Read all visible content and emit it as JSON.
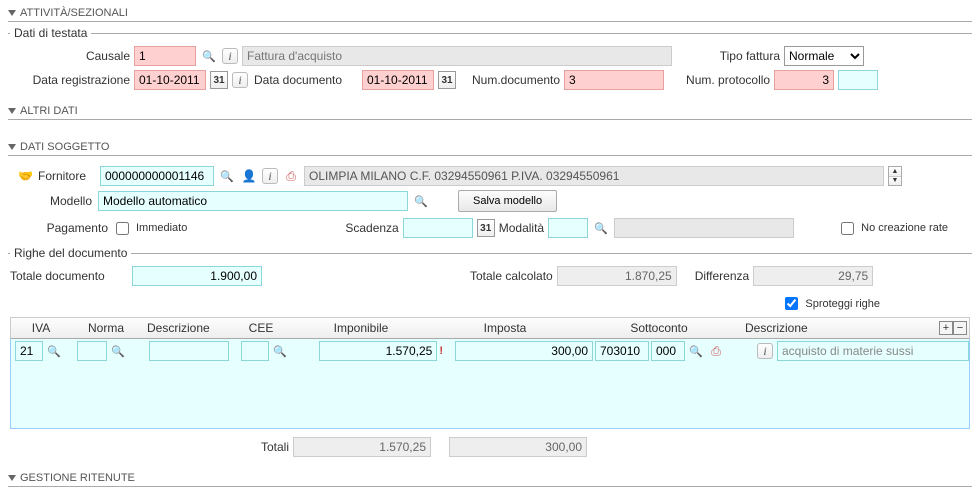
{
  "sections": {
    "attivita": "ATTIVITÀ/SEZIONALI",
    "altri": "ALTRI DATI",
    "soggetto": "DATI SOGGETTO",
    "ritenute": "GESTIONE RITENUTE"
  },
  "header": {
    "legend": "Dati di testata",
    "causale_label": "Causale",
    "causale_value": "1",
    "desc_placeholder": "Fattura d'acquisto",
    "tipo_label": "Tipo fattura",
    "tipo_value": "Normale",
    "data_reg_label": "Data registrazione",
    "data_reg_value": "01-10-2011",
    "data_doc_label": "Data documento",
    "data_doc_value": "01-10-2011",
    "num_doc_label": "Num.documento",
    "num_doc_value": "3",
    "num_prot_label": "Num. protocollo",
    "num_prot_value": "3"
  },
  "soggetto": {
    "fornitore_label": "Fornitore",
    "fornitore_code": "000000000001146",
    "fornitore_desc": "OLIMPIA MILANO C.F. 03294550961 P.IVA. 03294550961",
    "modello_label": "Modello",
    "modello_value": "Modello automatico",
    "save_btn": "Salva modello",
    "pagamento_label": "Pagamento",
    "immediato_label": "Immediato",
    "scadenza_label": "Scadenza",
    "modalita_label": "Modalità",
    "nocreazione_label": "No creazione rate"
  },
  "righe": {
    "legend": "Righe del documento",
    "tot_doc_label": "Totale documento",
    "tot_doc_value": "1.900,00",
    "tot_calc_label": "Totale calcolato",
    "tot_calc_value": "1.870,25",
    "diff_label": "Differenza",
    "diff_value": "29,75",
    "sprot_label": "Sproteggi righe",
    "cols": {
      "iva": "IVA",
      "norma": "Norma",
      "desc": "Descrizione",
      "cee": "CEE",
      "imponibile": "Imponibile",
      "imposta": "Imposta",
      "sottoconto": "Sottoconto",
      "desc2": "Descrizione"
    },
    "row": {
      "iva": "21",
      "norma": "",
      "desc": "",
      "cee": "",
      "imponibile": "1.570,25",
      "imposta": "300,00",
      "sotto1": "703010",
      "sotto2": "000",
      "desc2": "acquisto di materie sussi"
    },
    "footer": {
      "totali_label": "Totali",
      "tot_imp": "1.570,25",
      "tot_imposta": "300,00"
    }
  }
}
